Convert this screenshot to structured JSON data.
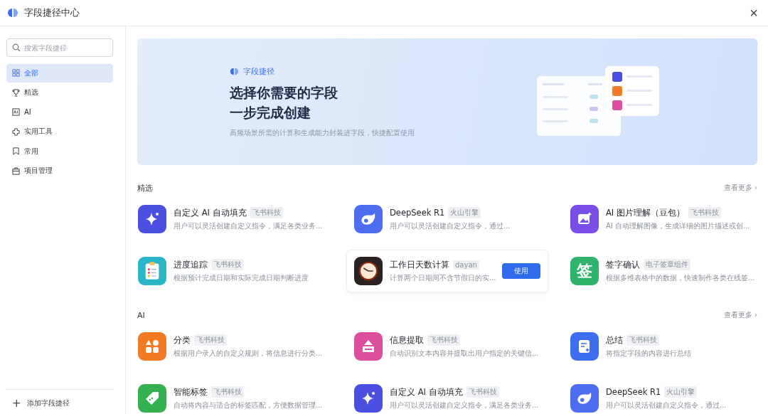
{
  "window": {
    "title": "字段捷径中心",
    "close": "×"
  },
  "sidebar": {
    "search": {
      "placeholder": "搜索字段捷径"
    },
    "items": [
      {
        "label": "全部",
        "kind": "grid",
        "selected": true
      },
      {
        "label": "精选",
        "kind": "trophy",
        "selected": false
      },
      {
        "label": "AI",
        "kind": "ai",
        "selected": false
      },
      {
        "label": "实用工具",
        "kind": "tools",
        "selected": false
      },
      {
        "label": "常用",
        "kind": "bookmark",
        "selected": false
      },
      {
        "label": "项目管理",
        "kind": "briefcase",
        "selected": false
      }
    ],
    "footer": {
      "icon": "+",
      "label": "添加字段捷径"
    }
  },
  "banner": {
    "brand": "字段捷径",
    "title_lines": [
      "选择你需要的字段",
      "一步完成创建"
    ],
    "subtitle": "高频场景所需的计算和生成能力封装进字段，快捷配置使用"
  },
  "sections": [
    {
      "title": "精选",
      "more": "查看更多 ›",
      "items": [
        {
          "name": "自定义 AI 自动填充",
          "tag": "飞书科技",
          "desc": "用户可以灵活创建自定义指令，满足各类业务...",
          "kind": "sparkle",
          "color": "#4a4fe0",
          "hovered": false
        },
        {
          "name": "DeepSeek R1",
          "tag": "火山引擎",
          "desc": "用户可以灵活创建自定义指令，通过...",
          "kind": "whale",
          "color": "#4e6ef2",
          "hovered": false
        },
        {
          "name": "AI 图片理解（豆包）",
          "tag": "飞书科技",
          "desc": "AI 自动理解图像，生成详细的图片描述或创...",
          "kind": "image",
          "color": "#7a4ee6",
          "hovered": false
        },
        {
          "name": "进度追踪",
          "tag": "飞书科技",
          "desc": "根据预计完成日期和实际完成日期判断进度",
          "kind": "checklist",
          "color": "#2bb5c9",
          "hovered": false
        },
        {
          "name": "工作日天数计算",
          "tag": "dayan",
          "desc": "计算两个日期间不含节假日的实...",
          "kind": "clock",
          "color": "#2a2220",
          "hovered": true,
          "action": "使用"
        },
        {
          "name": "签字确认",
          "tag": "电子签章组件",
          "desc": "根据多维表格中的数据，快速制作各类在线签...",
          "kind": "sign",
          "icon_text": "签",
          "color": "#2fb36b",
          "hovered": false
        }
      ]
    },
    {
      "title": "AI",
      "more": "查看更多 ›",
      "items": [
        {
          "name": "分类",
          "tag": "飞书科技",
          "desc": "根据用户录入的自定义规则，将信息进行分类...",
          "kind": "blocks",
          "color": "#f27a24",
          "hovered": false
        },
        {
          "name": "信息提取",
          "tag": "飞书科技",
          "desc": "自动识别文本内容并提取出用户指定的关键信...",
          "kind": "upload",
          "color": "#dd4f9c",
          "hovered": false
        },
        {
          "name": "总结",
          "tag": "飞书科技",
          "desc": "将指定字段的内容进行总结",
          "kind": "note",
          "color": "#3d6ef0",
          "hovered": false
        },
        {
          "name": "智能标签",
          "tag": "飞书科技",
          "desc": "自动将内容与适合的标签匹配，方便数据管理...",
          "kind": "tag",
          "color": "#33b24f",
          "hovered": false
        },
        {
          "name": "自定义 AI 自动填充",
          "tag": "飞书科技",
          "desc": "用户可以灵活创建自定义指令，满足各类业务...",
          "kind": "sparkle",
          "color": "#4a4fe0",
          "hovered": false
        },
        {
          "name": "DeepSeek R1",
          "tag": "火山引擎",
          "desc": "用户可以灵活创建自定义指令，通过...",
          "kind": "whale",
          "color": "#4e6ef2",
          "hovered": false
        }
      ]
    }
  ]
}
